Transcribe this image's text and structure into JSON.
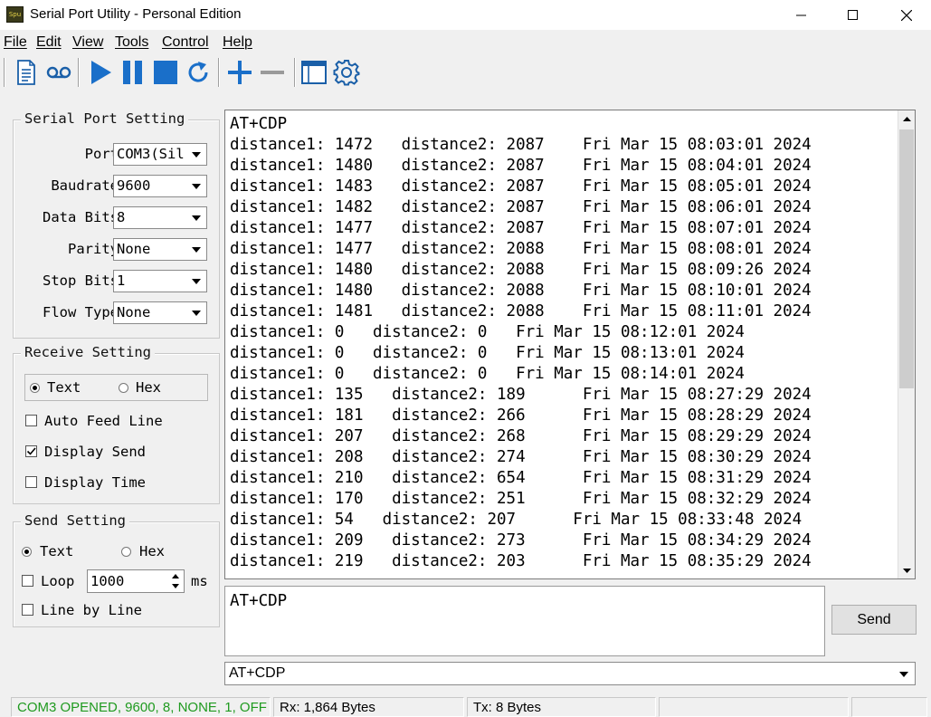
{
  "window": {
    "icon_text": "Spu",
    "title": "Serial Port Utility - Personal Edition"
  },
  "menu": [
    "File",
    "Edit",
    "View",
    "Tools",
    "Control",
    "Help"
  ],
  "toolbar": {
    "icons": [
      "new-document-icon",
      "record-icon",
      "play-icon",
      "pause-icon",
      "stop-icon",
      "refresh-icon",
      "plus-icon",
      "minus-icon",
      "window-icon",
      "gear-icon"
    ],
    "play_color": "#1a6fc9"
  },
  "serial_port_setting": {
    "title": "Serial Port Setting",
    "fields": [
      {
        "label": "Port",
        "value": "COM3(Sil"
      },
      {
        "label": "Baudrate",
        "value": "9600"
      },
      {
        "label": "Data Bits",
        "value": "8"
      },
      {
        "label": "Parity",
        "value": "None"
      },
      {
        "label": "Stop Bits",
        "value": "1"
      },
      {
        "label": "Flow Type",
        "value": "None"
      }
    ]
  },
  "receive_setting": {
    "title": "Receive Setting",
    "mode_text": "Text",
    "mode_hex": "Hex",
    "selected_mode": "Text",
    "auto_feed_line": "Auto Feed Line",
    "display_send": "Display Send",
    "display_time": "Display Time",
    "auto_feed_checked": false,
    "display_send_checked": true,
    "display_time_checked": false
  },
  "send_setting": {
    "title": "Send Setting",
    "mode_text": "Text",
    "mode_hex": "Hex",
    "selected_mode": "Text",
    "loop_label": "Loop",
    "loop_value": "1000",
    "loop_unit": "ms",
    "line_by_line": "Line by Line",
    "loop_checked": false,
    "line_by_line_checked": false
  },
  "receive_log": [
    "AT+CDP",
    "distance1: 1472   distance2: 2087    Fri Mar 15 08:03:01 2024",
    "distance1: 1480   distance2: 2087    Fri Mar 15 08:04:01 2024",
    "distance1: 1483   distance2: 2087    Fri Mar 15 08:05:01 2024",
    "distance1: 1482   distance2: 2087    Fri Mar 15 08:06:01 2024",
    "distance1: 1477   distance2: 2087    Fri Mar 15 08:07:01 2024",
    "distance1: 1477   distance2: 2088    Fri Mar 15 08:08:01 2024",
    "distance1: 1480   distance2: 2088    Fri Mar 15 08:09:26 2024",
    "distance1: 1480   distance2: 2088    Fri Mar 15 08:10:01 2024",
    "distance1: 1481   distance2: 2088    Fri Mar 15 08:11:01 2024",
    "distance1: 0   distance2: 0   Fri Mar 15 08:12:01 2024",
    "distance1: 0   distance2: 0   Fri Mar 15 08:13:01 2024",
    "distance1: 0   distance2: 0   Fri Mar 15 08:14:01 2024",
    "distance1: 135   distance2: 189      Fri Mar 15 08:27:29 2024",
    "distance1: 181   distance2: 266      Fri Mar 15 08:28:29 2024",
    "distance1: 207   distance2: 268      Fri Mar 15 08:29:29 2024",
    "distance1: 208   distance2: 274      Fri Mar 15 08:30:29 2024",
    "distance1: 210   distance2: 654      Fri Mar 15 08:31:29 2024",
    "distance1: 170   distance2: 251      Fri Mar 15 08:32:29 2024",
    "distance1: 54   distance2: 207      Fri Mar 15 08:33:48 2024",
    "distance1: 209   distance2: 273      Fri Mar 15 08:34:29 2024",
    "distance1: 219   distance2: 203      Fri Mar 15 08:35:29 2024"
  ],
  "send_input": "AT+CDP",
  "send_button": "Send",
  "history_value": "AT+CDP",
  "status": {
    "connection": "COM3 OPENED, 9600, 8, NONE, 1, OFF",
    "connection_color": "#1f9a1f",
    "rx": "Rx: 1,864 Bytes",
    "tx": "Tx: 8 Bytes"
  }
}
